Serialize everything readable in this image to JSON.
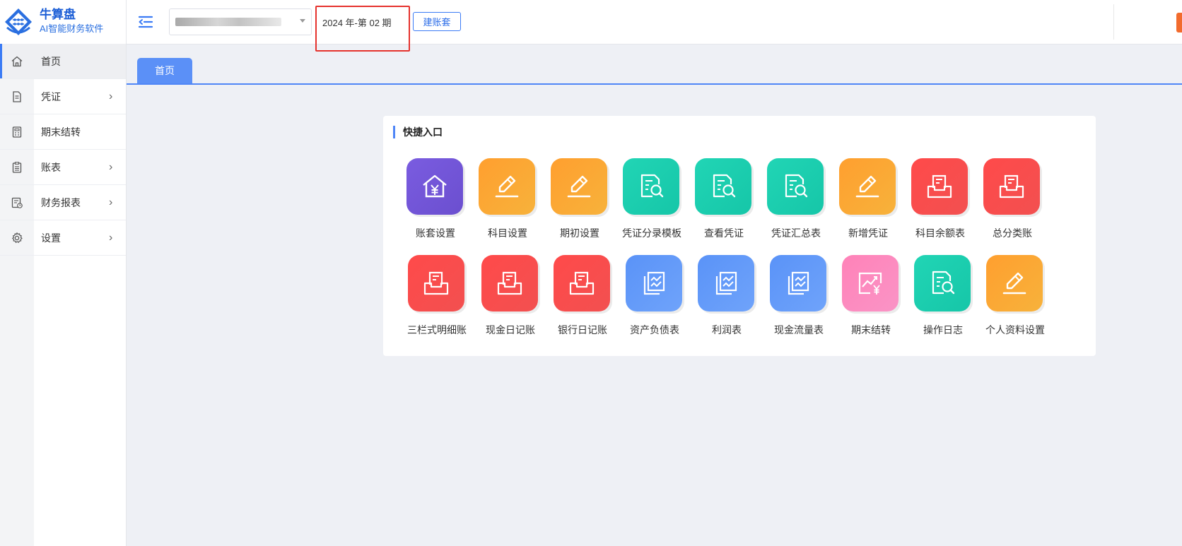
{
  "brand": {
    "name": "牛算盘",
    "tagline": "AI智能财务软件",
    "accent_color": "#2a6fe0"
  },
  "sidebar": {
    "items": [
      {
        "label": "首页",
        "icon": "home-icon",
        "active": true,
        "has_submenu": false
      },
      {
        "label": "凭证",
        "icon": "document-icon",
        "active": false,
        "has_submenu": true
      },
      {
        "label": "期末结转",
        "icon": "calculator-icon",
        "active": false,
        "has_submenu": false
      },
      {
        "label": "账表",
        "icon": "clipboard-icon",
        "active": false,
        "has_submenu": true
      },
      {
        "label": "财务报表",
        "icon": "report-icon",
        "active": false,
        "has_submenu": true
      },
      {
        "label": "设置",
        "icon": "gear-icon",
        "active": false,
        "has_submenu": true
      }
    ]
  },
  "header": {
    "company_select_value": "",
    "period": "2024 年-第 02 期",
    "new_book_button": "建账套"
  },
  "tabs": [
    {
      "label": "首页",
      "active": true
    }
  ],
  "quick_access": {
    "title": "快捷入口",
    "items": [
      {
        "label": "账套设置",
        "color": "purple",
        "icon": "house-yen-icon"
      },
      {
        "label": "科目设置",
        "color": "orange",
        "icon": "pencil-icon"
      },
      {
        "label": "期初设置",
        "color": "orange",
        "icon": "pencil-icon"
      },
      {
        "label": "凭证分录模板",
        "color": "teal",
        "icon": "doc-search-icon"
      },
      {
        "label": "查看凭证",
        "color": "teal",
        "icon": "doc-search-icon"
      },
      {
        "label": "凭证汇总表",
        "color": "teal",
        "icon": "doc-search-icon"
      },
      {
        "label": "新增凭证",
        "color": "orange",
        "icon": "pencil-icon"
      },
      {
        "label": "科目余额表",
        "color": "red",
        "icon": "inbox-doc-icon"
      },
      {
        "label": "总分类账",
        "color": "red",
        "icon": "inbox-doc-icon"
      },
      {
        "label": "三栏式明细账",
        "color": "red",
        "icon": "inbox-doc-icon"
      },
      {
        "label": "现金日记账",
        "color": "red",
        "icon": "inbox-doc-icon"
      },
      {
        "label": "银行日记账",
        "color": "red",
        "icon": "inbox-doc-icon"
      },
      {
        "label": "资产负债表",
        "color": "blue",
        "icon": "stacked-chart-icon"
      },
      {
        "label": "利润表",
        "color": "blue",
        "icon": "stacked-chart-icon"
      },
      {
        "label": "现金流量表",
        "color": "blue",
        "icon": "stacked-chart-icon"
      },
      {
        "label": "期末结转",
        "color": "pink",
        "icon": "trend-yen-icon"
      },
      {
        "label": "操作日志",
        "color": "teal",
        "icon": "doc-search-icon"
      },
      {
        "label": "个人资料设置",
        "color": "orange",
        "icon": "pencil-icon"
      }
    ]
  },
  "colors": {
    "purple": "#6f52d6",
    "orange": "#fba434",
    "teal": "#1dd0b0",
    "red": "#f64a4a",
    "blue": "#6199f8",
    "pink": "#fd8bbf",
    "highlight_box": "#e5322d"
  }
}
